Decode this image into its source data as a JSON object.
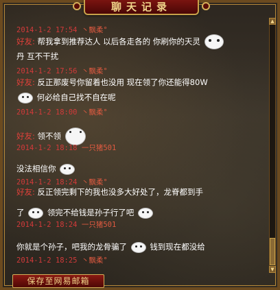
{
  "window": {
    "title": "聊天记录"
  },
  "scroll": {
    "up_glyph": "▲",
    "down_glyph": "▼"
  },
  "messages": [
    {
      "time": "2014-1-2 17:54",
      "nick": "丶飘柔°",
      "prefix": "好友:",
      "text": "帮我拿到推荐达人 以后各走各的 你刷你的天灵"
    },
    {
      "continuation": "丹 互不干扰"
    },
    {
      "time": "2014-1-2 17:56",
      "nick": "丶飘柔°",
      "prefix": "好友:",
      "text": "反正那废号你留着也没用 现在领了你还能得80W"
    },
    {
      "continuation": "何必给自己找不自在呢"
    },
    {
      "time": "2014-1-2 18:00",
      "nick": "丶飘柔°"
    },
    {
      "prefix": "好友:",
      "text": "领不领"
    },
    {
      "time": "2014-1-2 18:18",
      "nick": "一只猪501"
    },
    {
      "text": "没法相信你"
    },
    {
      "time": "2014-1-2 18:24",
      "nick": "丶飘柔°",
      "prefix": "好友:",
      "text": "反正领完剩下的我也没多大好处了，龙脊都到手"
    },
    {
      "continuation": "了",
      "continuation2": "领完不给钱是孙子行了吧"
    },
    {
      "time": "2014-1-2 18:24",
      "nick": "一只猪501"
    },
    {
      "text": "你就是个孙子，吧我的龙骨骗了",
      "text2": "钱到现在都没给"
    },
    {
      "time": "2014-1-2 18:25",
      "nick": "丶飘柔°"
    }
  ],
  "footer": {
    "save_label": "保存至网易邮箱"
  },
  "colors": {
    "frame": "#6b4a1f",
    "gold": "#c9a24a",
    "meta_red": "#d23a3a",
    "text": "#ffffff"
  }
}
